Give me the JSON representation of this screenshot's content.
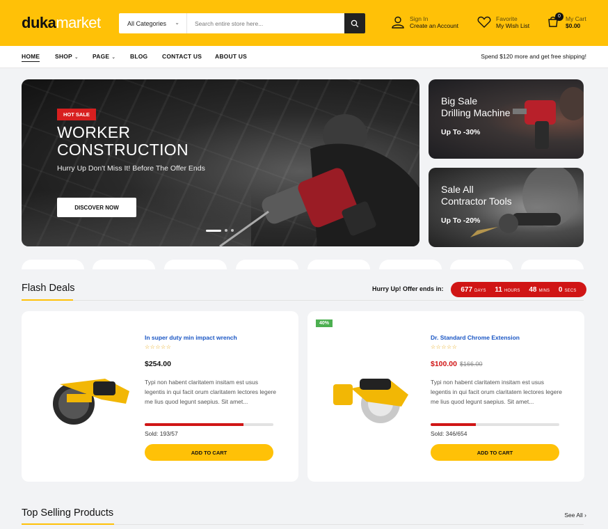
{
  "header": {
    "logo_a": "duka",
    "logo_b": "market",
    "category_label": "All Categories",
    "search_placeholder": "Search entire store here...",
    "account": {
      "small": "Sign In",
      "big": "Create an Account"
    },
    "wishlist": {
      "small": "Favorite",
      "big": "My Wish List"
    },
    "cart": {
      "small": "My Cart",
      "big": "$0.00",
      "count": "0"
    }
  },
  "nav": {
    "items": [
      {
        "label": "HOME"
      },
      {
        "label": "SHOP"
      },
      {
        "label": "PAGE"
      },
      {
        "label": "BLOG"
      },
      {
        "label": "CONTACT US"
      },
      {
        "label": "ABOUT US"
      }
    ],
    "shipping": "Spend $120 more and get free shipping!"
  },
  "hero": {
    "badge": "HOT SALE",
    "title_line1": "WORKER",
    "title_line2": "CONSTRUCTION",
    "subtitle": "Hurry Up Don't Miss It! Before The Offer Ends",
    "button": "DISCOVER NOW"
  },
  "side_banners": [
    {
      "line1": "Big Sale",
      "line2": "Drilling Machine",
      "offer": "Up To -30%"
    },
    {
      "line1": "Sale All",
      "line2": "Contractor Tools",
      "offer": "Up To -20%"
    }
  ],
  "flash": {
    "title": "Flash Deals",
    "hurry": "Hurry Up! Offer ends in:",
    "timer": [
      {
        "n": "677",
        "l": "DAYS"
      },
      {
        "n": "11",
        "l": "HOURS"
      },
      {
        "n": "48",
        "l": "MINS"
      },
      {
        "n": "0",
        "l": "SECS"
      }
    ],
    "products": [
      {
        "name": "In super duty min impact wrench",
        "stars": "☆☆☆☆☆",
        "price": "$254.00",
        "old_price": "",
        "discount": "",
        "desc": "Typi non habent claritatem insitam est usus legentis in qui facit orum claritatem lectores legere me lius quod legunt saepius. Sit amet...",
        "sold_fraction": 0.77,
        "sold": "Sold: 193/57",
        "button": "ADD TO CART"
      },
      {
        "name": "Dr. Standard Chrome Extension",
        "stars": "☆☆☆☆☆",
        "price": "$100.00",
        "old_price": "$166.00",
        "discount": "40%",
        "desc": "Typi non habent claritatem insitam est usus legentis in qui facit orum claritatem lectores legere me lius quod legunt saepius. Sit amet...",
        "sold_fraction": 0.35,
        "sold": "Sold: 346/654",
        "button": "ADD TO CART"
      }
    ]
  },
  "top_selling": {
    "title": "Top Selling Products",
    "see_all": "See All"
  },
  "colors": {
    "brand": "#ffc107",
    "accent_red": "#d01515",
    "link_blue": "#1a56c4"
  }
}
